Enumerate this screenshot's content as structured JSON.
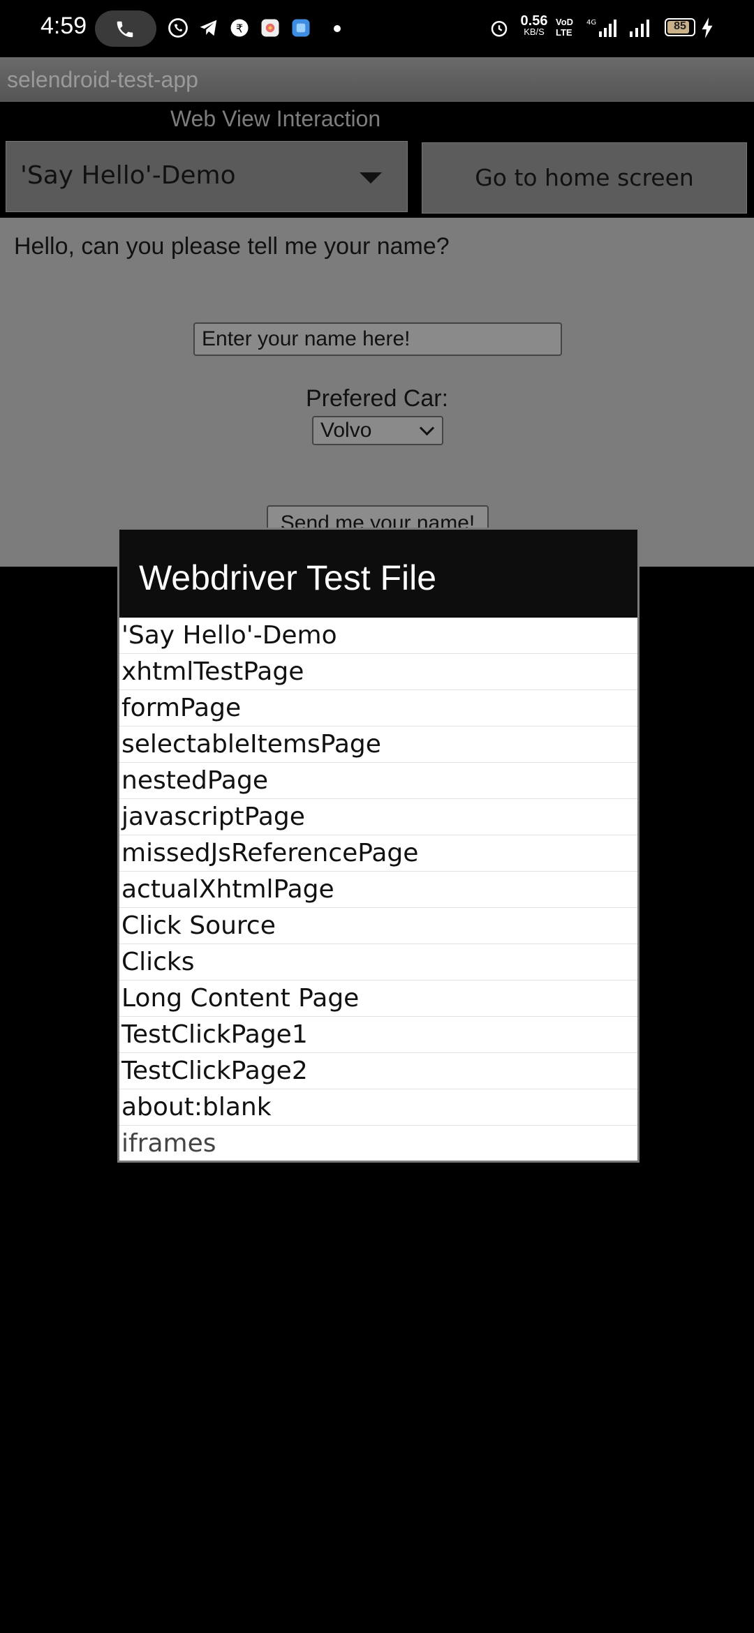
{
  "status_bar": {
    "time": "4:59",
    "net_speed_value": "0.56",
    "net_speed_unit": "KB/S",
    "volte_line1": "VoD",
    "volte_line2": "LTE",
    "battery_level": "85",
    "battery_fraction": 0.85,
    "icons": [
      "call-icon",
      "whatsapp-icon",
      "telegram-icon",
      "app-icon",
      "photos-icon",
      "files-icon",
      "alarm-icon",
      "signal-4g-icon",
      "signal-icon",
      "charging-icon"
    ]
  },
  "app": {
    "title": "selendroid-test-app",
    "subheader": "Web View Interaction",
    "spinner_value": "'Say Hello'-Demo",
    "home_button": "Go to home screen"
  },
  "webview": {
    "question": "Hello, can you please tell me your name?",
    "name_placeholder": "Enter your name here!",
    "car_label": "Prefered Car:",
    "car_value": "Volvo",
    "send_button": "Send me your name!"
  },
  "dialog": {
    "title": "Webdriver Test File",
    "items": [
      "'Say Hello'-Demo",
      "xhtmlTestPage",
      "formPage",
      "selectableItemsPage",
      "nestedPage",
      "javascriptPage",
      "missedJsReferencePage",
      "actualXhtmlPage",
      "Click Source",
      "Clicks",
      "Long Content Page",
      "TestClickPage1",
      "TestClickPage2",
      "about:blank",
      "iframes"
    ]
  }
}
